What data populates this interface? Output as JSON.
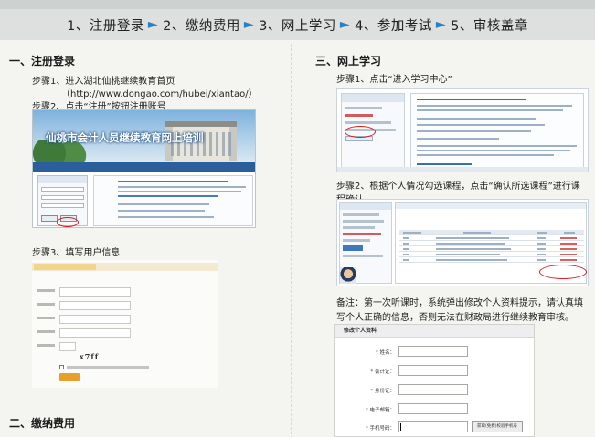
{
  "process_steps": [
    {
      "label": "1、注册登录"
    },
    {
      "label": "2、缴纳费用"
    },
    {
      "label": "3、网上学习"
    },
    {
      "label": "4、参加考试"
    },
    {
      "label": "5、审核盖章"
    }
  ],
  "colors": {
    "arrow": "#2a7fc4",
    "highlight_ring": "#d81e1e",
    "banner_bg": "#dde0de",
    "nav_blue": "#2b5f9c"
  },
  "left": {
    "section1_title": "一、注册登录",
    "step1": "步骤1、进入湖北仙桃继续教育首页",
    "step1_url": "（http://www.dongao.com/hubei/xiantao/）",
    "step2": "步骤2、点击“注册”按钮注册账号",
    "shot1_title": "仙桃市会计人员继续教育网上培训",
    "step3": "步骤3、填写用户信息",
    "captcha": "x7ff",
    "section2_title": "二、缴纳费用"
  },
  "right": {
    "section3_title": "三、网上学习",
    "step1": "步骤1、点击“进入学习中心”",
    "step2": "步骤2、根据个人情况勾选课程，点击“确认所选课程”进行课程确认。",
    "note": "备注：第一次听课时，系统弹出修改个人资料提示，请认真填写个人正确的信息，否则无法在财政局进行继续教育审核。",
    "modify_title": "修改个人资料",
    "fields": [
      {
        "label": "* 姓名："
      },
      {
        "label": "* 会计证："
      },
      {
        "label": "* 身份证："
      },
      {
        "label": "* 电子邮箱："
      },
      {
        "label": "* 手机号码："
      }
    ],
    "get_code_button": "获取(免费)校验手机号"
  }
}
